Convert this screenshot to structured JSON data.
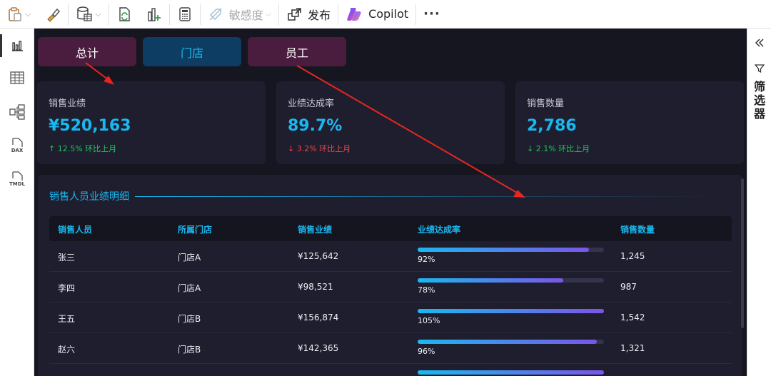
{
  "toolbar": {
    "sensitivity_label": "敏感度",
    "publish_label": "发布",
    "copilot_label": "Copilot",
    "more_label": "···"
  },
  "left_rail": {
    "items": [
      {
        "icon": "bar-chart-icon",
        "active": true
      },
      {
        "icon": "table-grid-icon",
        "active": false
      },
      {
        "icon": "model-icon",
        "active": false
      },
      {
        "icon": "dax-icon",
        "text": "DAX",
        "active": false
      },
      {
        "icon": "tmdl-icon",
        "text": "TMDL",
        "active": false
      }
    ]
  },
  "right_pane": {
    "collapse_icon": "chevron-double-left-icon",
    "filter_icon": "funnel-icon",
    "filter_label": "筛选器"
  },
  "tabs": [
    {
      "label": "总计",
      "color": "#4a1d3f"
    },
    {
      "label": "门店",
      "color": "#0d3d63"
    },
    {
      "label": "员工",
      "color": "#4a1d3f"
    }
  ],
  "kpis": [
    {
      "title": "销售业绩",
      "value": "¥520,163",
      "delta": "↑ 12.5% 环比上月",
      "delta_color": "#22c55e"
    },
    {
      "title": "业绩达成率",
      "value": "89.7%",
      "delta": "↓ 3.2% 环比上月",
      "delta_color": "#ef4444"
    },
    {
      "title": "销售数量",
      "value": "2,786",
      "delta": "↓ 2.1% 环比上月",
      "delta_color": "#22c55e"
    }
  ],
  "detail": {
    "title": "销售人员业绩明细",
    "columns": [
      "销售人员",
      "所属门店",
      "销售业绩",
      "业绩达成率",
      "销售数量"
    ],
    "rows": [
      {
        "name": "张三",
        "store": "门店A",
        "sales": "¥125,642",
        "rate": "92%",
        "rate_value": 0.92,
        "qty": "1,245"
      },
      {
        "name": "李四",
        "store": "门店A",
        "sales": "¥98,521",
        "rate": "78%",
        "rate_value": 0.78,
        "qty": "987"
      },
      {
        "name": "王五",
        "store": "门店B",
        "sales": "¥156,874",
        "rate": "105%",
        "rate_value": 1.0,
        "qty": "1,542"
      },
      {
        "name": "赵六",
        "store": "门店B",
        "sales": "¥142,365",
        "rate": "96%",
        "rate_value": 0.96,
        "qty": "1,321"
      }
    ]
  },
  "colors": {
    "accent": "#1ab8f0",
    "canvas_bg": "#161620",
    "card_bg": "#1e1e2f",
    "annotation_arrow": "#e8261f"
  }
}
